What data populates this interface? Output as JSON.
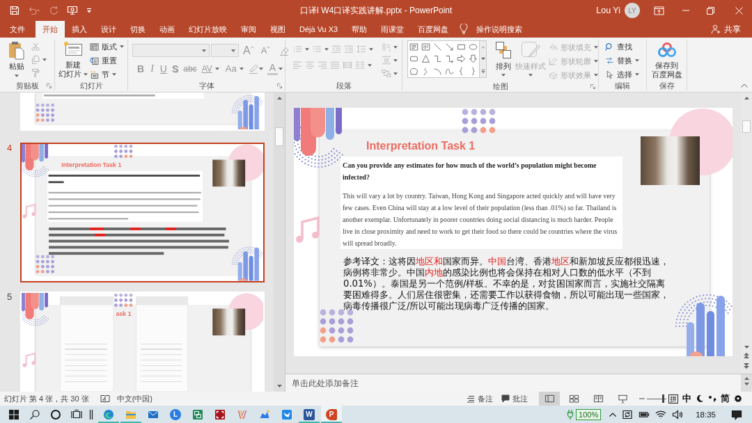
{
  "title_bar": {
    "quick_access": [
      {
        "kind": "save",
        "disabled": false
      },
      {
        "kind": "undo",
        "disabled": true
      },
      {
        "kind": "redo",
        "disabled": true
      },
      {
        "kind": "presenter",
        "disabled": false
      },
      {
        "kind": "customize",
        "disabled": false
      }
    ],
    "document_title": "口译I W4口译实践讲解.pptx - PowerPoint",
    "user_name": "Lou Yi",
    "user_initials": "LY"
  },
  "tabs": [
    {
      "label": "文件",
      "selected": false
    },
    {
      "label": "开始",
      "selected": true
    },
    {
      "label": "插入",
      "selected": false
    },
    {
      "label": "设计",
      "selected": false
    },
    {
      "label": "切换",
      "selected": false
    },
    {
      "label": "动画",
      "selected": false
    },
    {
      "label": "幻灯片放映",
      "selected": false
    },
    {
      "label": "审阅",
      "selected": false
    },
    {
      "label": "视图",
      "selected": false
    },
    {
      "label": "Déjà Vu X3",
      "selected": false
    },
    {
      "label": "帮助",
      "selected": false
    },
    {
      "label": "雨课堂",
      "selected": false
    },
    {
      "label": "百度网盘",
      "selected": false
    }
  ],
  "tell_me": {
    "placeholder": "操作说明搜索"
  },
  "share": "共享",
  "ribbon": {
    "clipboard": {
      "label": "剪贴板",
      "paste": "粘贴",
      "tools_disabled": true
    },
    "slides": {
      "label": "幻灯片",
      "new_slide": [
        "新建",
        "幻灯片"
      ],
      "layout": "版式",
      "reset": "重置",
      "section": "节"
    },
    "font": {
      "label": "字体",
      "disabled": true,
      "top_buttons": [
        {
          "kind": "grow",
          "text": "A"
        },
        {
          "kind": "shrink",
          "text": "A"
        },
        {
          "kind": "clear"
        }
      ],
      "bottom_buttons": [
        {
          "kind": "bold",
          "text": "B"
        },
        {
          "kind": "italic",
          "text": "I"
        },
        {
          "kind": "underline",
          "text": "U"
        },
        {
          "kind": "shadow",
          "text": "S"
        },
        {
          "kind": "strikethrough",
          "text": "abc"
        },
        {
          "kind": "spacing",
          "text": "AV"
        },
        {
          "kind": "case",
          "text": "Aa"
        },
        {
          "kind": "highlight"
        },
        {
          "kind": "color",
          "text": "A"
        }
      ]
    },
    "paragraph": {
      "label": "段落",
      "disabled": true
    },
    "drawing": {
      "label": "绘图",
      "arrange": "排列",
      "quick_styles": {
        "label": "快速样式",
        "disabled": true
      },
      "shape_options": [
        {
          "kind": "fill",
          "label": "形状填充",
          "disabled": true
        },
        {
          "kind": "outline",
          "label": "形状轮廓",
          "disabled": true
        },
        {
          "kind": "effects",
          "label": "形状效果",
          "disabled": true
        }
      ]
    },
    "editing": {
      "label": "编辑",
      "items": [
        {
          "kind": "find",
          "label": "查找"
        },
        {
          "kind": "replace",
          "label": "替换"
        },
        {
          "kind": "select",
          "label": "选择"
        }
      ]
    },
    "save": {
      "label": "保存",
      "button": [
        "保存到",
        "百度网盘"
      ]
    }
  },
  "thumbnails": [
    {
      "kind": "cropped",
      "selected": false
    },
    {
      "kind": "text_slide",
      "number": "4",
      "selected": true,
      "title": "Interpretation Task 1"
    },
    {
      "kind": "screenshot_slide",
      "number": "5",
      "selected": false,
      "title_fragment": "ask 1"
    }
  ],
  "slide": {
    "title": "Interpretation Task 1",
    "question": "Can you provide any estimates for how much of the world’s population might become infected?",
    "answer": "This will vary a lot by country. Taiwan, Hong Kong and Singapore acted quickly and will have very few cases. Even China will stay at a low level of their population (less than .01%) so far. Thailand is another exemplar. Unfortunately in poorer countries doing social distancing is much harder. People live in close proximity and need to work to get their food so there could be countries where the virus will spread broadly.",
    "translation": [
      {
        "text": "参考译文：这将因",
        "highlighted": false
      },
      {
        "text": "地区和",
        "highlighted": true
      },
      {
        "text": "国家而异。",
        "highlighted": false
      },
      {
        "text": "中国",
        "highlighted": true
      },
      {
        "text": "台湾、香港",
        "highlighted": false
      },
      {
        "text": "地区",
        "highlighted": true
      },
      {
        "text": "和新加坡反应都很迅速，病例将非常少。中国",
        "highlighted": false
      },
      {
        "text": "内地",
        "highlighted": true
      },
      {
        "text": "的感染比例也将会保持在相对人口数的低水平（不到0.01%）。泰国是另一个范例/样板。不幸的是，对贫困国家而言，实施社交隔离要困难得多。人们居住很密集，还需要工作以获得食物，所以可能出现一些国家，病毒传播很广泛/所以可能出现病毒广泛传播的国家。",
        "highlighted": false
      }
    ]
  },
  "notes": {
    "placeholder": "单击此处添加备注"
  },
  "status_bar": {
    "slide_info": "幻灯片 第 4 张，共 30 张",
    "language": "中文(中国)",
    "notes_button": "备注",
    "comments_button": "批注",
    "views": [
      {
        "kind": "normal",
        "selected": true
      },
      {
        "kind": "sorter",
        "selected": false
      },
      {
        "kind": "reading",
        "selected": false
      },
      {
        "kind": "slideshow",
        "selected": false
      }
    ],
    "zoom": {
      "level": 0.9
    }
  },
  "ime_toolbar": {
    "input_method": "拼",
    "mode": "中",
    "script": "简"
  },
  "taskbar": {
    "apps": [
      {
        "kind": "browser",
        "running": true,
        "active": false
      },
      {
        "kind": "folder",
        "running": true,
        "active": false
      },
      {
        "kind": "mail",
        "running": false,
        "active": false
      },
      {
        "kind": "letter",
        "glyph": "L",
        "running": false,
        "active": false
      },
      {
        "kind": "monitor",
        "running": false,
        "active": false
      },
      {
        "kind": "capture",
        "running": false,
        "active": false
      },
      {
        "kind": "stripes",
        "running": false,
        "active": false
      },
      {
        "kind": "cloud",
        "running": false,
        "active": false
      },
      {
        "kind": "bird",
        "running": false,
        "active": false
      },
      {
        "kind": "word",
        "glyph": "W",
        "running": true,
        "active": false
      },
      {
        "kind": "slides",
        "glyph": "P",
        "running": true,
        "active": true
      }
    ],
    "battery": "100%",
    "time": "18:35"
  }
}
